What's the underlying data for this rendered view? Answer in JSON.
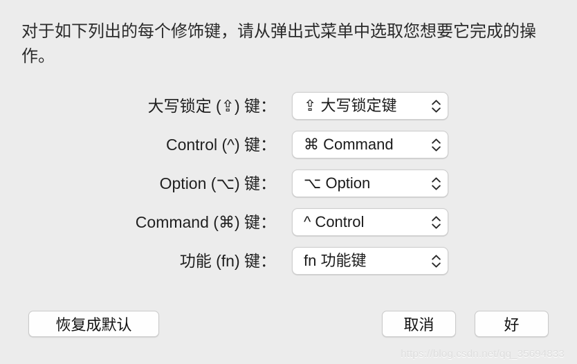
{
  "dialog": {
    "description": "对于如下列出的每个修饰键，请从弹出式菜单中选取您想要它完成的操作。",
    "background_color": "#ececec"
  },
  "rows": [
    {
      "label": "大写锁定 (⇪) 键：",
      "value": "⇪ 大写锁定键"
    },
    {
      "label": "Control (^) 键：",
      "value": "⌘ Command"
    },
    {
      "label": "Option (⌥) 键：",
      "value": "⌥ Option"
    },
    {
      "label": "Command (⌘) 键：",
      "value": "^ Control"
    },
    {
      "label": "功能 (fn) 键：",
      "value": "fn 功能键"
    }
  ],
  "buttons": {
    "restore_defaults": "恢复成默认",
    "cancel": "取消",
    "ok": "好"
  },
  "watermark": "https://blog.csdn.net/qq_35694833"
}
